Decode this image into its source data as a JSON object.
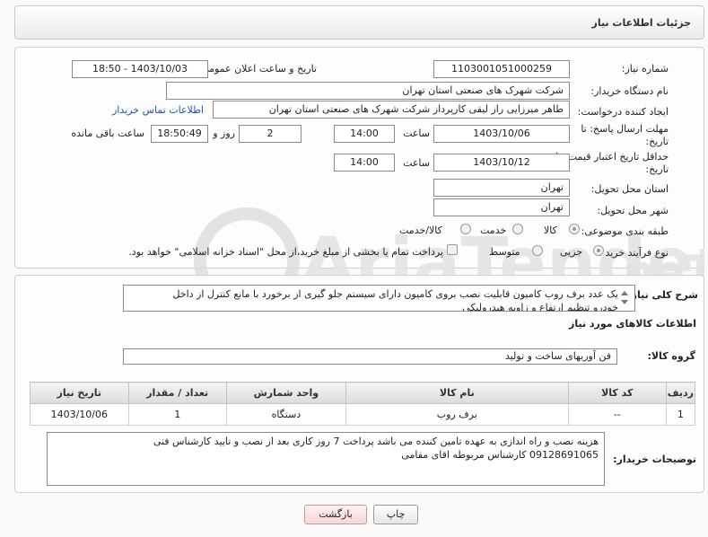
{
  "header": {
    "title": "جزئیات اطلاعات نیاز"
  },
  "form": {
    "need_number_label": "شماره نیاز:",
    "need_number": "1103001051000259",
    "announce_label": "تاریخ و ساعت اعلان عمومی:",
    "announce_value": "1403/10/03 - 18:50",
    "buyer_org_label": "نام دستگاه خریدار:",
    "buyer_org": "شرکت شهرک های صنعتی استان تهران",
    "requester_label": "ایجاد کننده درخواست:",
    "requester": "طاهر  میرزایی راز لیقی کارپرداز شرکت شهرک های صنعتی استان تهران",
    "contact_link": "اطلاعات تماس خریدار",
    "deadline_label_1": "مهلت ارسال پاسخ: تا",
    "deadline_label_2": "تاریخ:",
    "deadline_date": "1403/10/06",
    "time_label": "ساعت",
    "deadline_time": "14:00",
    "days_value": "2",
    "days_label": "روز و",
    "remaining_time": "18:50:49",
    "remaining_label": "ساعت باقی مانده",
    "validity_label_1": "حداقل تاریخ اعتبار قیمت: تا",
    "validity_label_2": "تاریخ:",
    "validity_date": "1403/10/12",
    "validity_time": "14:00",
    "province_label": "استان محل تحویل:",
    "province": "تهران",
    "city_label": "شهر محل تحویل:",
    "city": "تهران",
    "category_label": "طبقه بندی موضوعی:",
    "category_options": [
      "کالا",
      "خدمت",
      "کالا/خدمت"
    ],
    "category_selected": "کالا",
    "purchase_label": "نوع فرآیند خرید :",
    "purchase_options": [
      "جزیی",
      "متوسط"
    ],
    "purchase_selected": "جزیی",
    "payment_note": "پرداخت تمام یا بخشی از مبلغ خرید،از محل \"اسناد خزانه اسلامی\" خواهد بود."
  },
  "details": {
    "summary_label": "شرح کلی نیاز:",
    "summary_line1": "یک عدد برف روب کامیون قابلیت نصب بروی کامیون دارای سیستم جلو گیری از برخورد با مانع  کنترل از داخل",
    "summary_line2": "خودرو  تنظیم ارتفاع و زاویه هیدرولیکی",
    "goods_section_title": "اطلاعات کالاهای مورد نیاز",
    "goods_group_label": "گروه کالا:",
    "goods_group": "فن آوریهای ساخت و تولید",
    "table": {
      "headers": [
        "ردیف",
        "کد کالا",
        "نام کالا",
        "واحد شمارش",
        "تعداد / مقدار",
        "تاریخ نیاز"
      ],
      "rows": [
        [
          "1",
          "--",
          "برف روب",
          "دستگاه",
          "1",
          "1403/10/06"
        ]
      ]
    },
    "buyer_notes_label": "توضیحات خریدار:",
    "buyer_notes_line1": "هزینه نصب و راه اندازی به عهده تامین کننده می باشد   پرداخت 7 روز کاری بعد از نصب و تایید کارشناس فنی",
    "buyer_notes_line2": "09128691065 کارشناس مربوطه اقای مقامی"
  },
  "buttons": {
    "print": "چاپ",
    "back": "بازگشت"
  },
  "colors": {
    "link": "#1a56b0",
    "watermark": "#d9d9d9"
  }
}
